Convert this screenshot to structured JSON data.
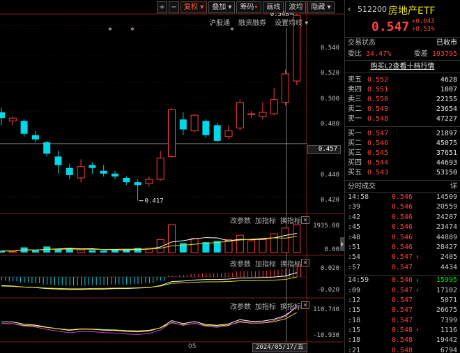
{
  "toolbar": {
    "plus": "+",
    "minus": "−",
    "fq": "复权",
    "overlay": "叠加",
    "chips": "筹码",
    "draw": "画线",
    "kline": "波均",
    "hide": "隐藏",
    "menu_arrow": "▾"
  },
  "sub_links": [
    "沪股通",
    "融资融券",
    "设置均线"
  ],
  "panel_tools": {
    "params": "改参数",
    "add": "加指标",
    "swap": "换指标"
  },
  "price_axis": [
    "0.540",
    "0.520",
    "0.500",
    "0.480",
    "0.460",
    "0.440",
    "0.420"
  ],
  "current_price_tag": "0.457",
  "high_label": "0.548",
  "low_label": "0.417",
  "volume_axis": [
    "1935.00",
    "0.00"
  ],
  "macd_axis": [
    "0.020",
    "-0.020"
  ],
  "ind3_axis": [
    "110.740",
    "-10.930"
  ],
  "x_tick": "05",
  "date_badge": "2024/05/17/五",
  "chart_data": {
    "type": "candlestick",
    "ylim": [
      0.41,
      0.55
    ],
    "candles": [
      {
        "o": 0.479,
        "h": 0.482,
        "l": 0.47,
        "c": 0.475
      },
      {
        "o": 0.473,
        "h": 0.476,
        "l": 0.47,
        "c": 0.475
      },
      {
        "o": 0.473,
        "h": 0.474,
        "l": 0.462,
        "c": 0.464
      },
      {
        "o": 0.463,
        "h": 0.466,
        "l": 0.458,
        "c": 0.46
      },
      {
        "o": 0.458,
        "h": 0.459,
        "l": 0.448,
        "c": 0.45
      },
      {
        "o": 0.448,
        "h": 0.452,
        "l": 0.436,
        "c": 0.442
      },
      {
        "o": 0.44,
        "h": 0.443,
        "l": 0.432,
        "c": 0.435
      },
      {
        "o": 0.433,
        "h": 0.446,
        "l": 0.43,
        "c": 0.441
      },
      {
        "o": 0.442,
        "h": 0.444,
        "l": 0.436,
        "c": 0.44
      },
      {
        "o": 0.438,
        "h": 0.442,
        "l": 0.434,
        "c": 0.436
      },
      {
        "o": 0.436,
        "h": 0.438,
        "l": 0.432,
        "c": 0.434
      },
      {
        "o": 0.433,
        "h": 0.434,
        "l": 0.428,
        "c": 0.43
      },
      {
        "o": 0.43,
        "h": 0.432,
        "l": 0.417,
        "c": 0.428
      },
      {
        "o": 0.429,
        "h": 0.434,
        "l": 0.427,
        "c": 0.432
      },
      {
        "o": 0.432,
        "h": 0.452,
        "l": 0.431,
        "c": 0.447
      },
      {
        "o": 0.448,
        "h": 0.482,
        "l": 0.447,
        "c": 0.481
      },
      {
        "o": 0.474,
        "h": 0.479,
        "l": 0.463,
        "c": 0.467
      },
      {
        "o": 0.466,
        "h": 0.478,
        "l": 0.465,
        "c": 0.477
      },
      {
        "o": 0.473,
        "h": 0.474,
        "l": 0.461,
        "c": 0.463
      },
      {
        "o": 0.47,
        "h": 0.472,
        "l": 0.458,
        "c": 0.459
      },
      {
        "o": 0.462,
        "h": 0.47,
        "l": 0.46,
        "c": 0.466
      },
      {
        "o": 0.468,
        "h": 0.488,
        "l": 0.466,
        "c": 0.486
      },
      {
        "o": 0.478,
        "h": 0.48,
        "l": 0.475,
        "c": 0.478
      },
      {
        "o": 0.476,
        "h": 0.486,
        "l": 0.474,
        "c": 0.479
      },
      {
        "o": 0.478,
        "h": 0.496,
        "l": 0.477,
        "c": 0.488
      },
      {
        "o": 0.486,
        "h": 0.509,
        "l": 0.484,
        "c": 0.506
      },
      {
        "o": 0.501,
        "h": 0.548,
        "l": 0.498,
        "c": 0.547
      }
    ],
    "volume": [
      120,
      80,
      360,
      150,
      420,
      260,
      300,
      180,
      160,
      140,
      200,
      210,
      320,
      300,
      900,
      1935,
      650,
      980,
      720,
      800,
      900,
      1200,
      820,
      900,
      1300,
      1700,
      1935
    ],
    "macd": [
      -0.006,
      -0.007,
      -0.009,
      -0.01,
      -0.012,
      -0.013,
      -0.014,
      -0.014,
      -0.013,
      -0.013,
      -0.012,
      -0.012,
      -0.011,
      -0.01,
      -0.006,
      0.002,
      0.003,
      0.005,
      0.006,
      0.006,
      0.007,
      0.009,
      0.009,
      0.01,
      0.011,
      0.013,
      0.02
    ]
  },
  "quote": {
    "code": "512200",
    "name": "房地产ETF",
    "price": "0.547",
    "change": "+0.043",
    "change_pct": "+8.53%",
    "status_label": "交易状态",
    "status_value": "已收市",
    "weibi_label": "委比",
    "weibi_value": "34.47%",
    "weicha_label": "委差",
    "weicha_value": "103795",
    "l2_link": "购买L2查看十档行情"
  },
  "asks": [
    {
      "label": "卖五",
      "price": "0.552",
      "vol": "4628"
    },
    {
      "label": "卖四",
      "price": "0.551",
      "vol": "1007"
    },
    {
      "label": "卖三",
      "price": "0.550",
      "vol": "22155"
    },
    {
      "label": "卖二",
      "price": "0.549",
      "vol": "23654"
    },
    {
      "label": "卖一",
      "price": "0.548",
      "vol": "47227"
    }
  ],
  "bids": [
    {
      "label": "买一",
      "price": "0.547",
      "vol": "21897"
    },
    {
      "label": "买二",
      "price": "0.546",
      "vol": "45075"
    },
    {
      "label": "买三",
      "price": "0.545",
      "vol": "37651"
    },
    {
      "label": "买四",
      "price": "0.544",
      "vol": "44693"
    },
    {
      "label": "买五",
      "price": "0.543",
      "vol": "53150"
    }
  ],
  "trades_header": {
    "title": "分时成交",
    "detail": "详"
  },
  "trades_a": [
    {
      "t": "14:58",
      "p": "0.546",
      "dir": "",
      "v": "14509"
    },
    {
      "t": ":39",
      "p": "0.546",
      "dir": "",
      "v": "20559"
    },
    {
      "t": ":42",
      "p": "0.546",
      "dir": "",
      "v": "24207"
    },
    {
      "t": ":45",
      "p": "0.546",
      "dir": "",
      "v": "23474"
    },
    {
      "t": ":48",
      "p": "0.546",
      "dir": "",
      "v": "44889"
    },
    {
      "t": ":51",
      "p": "0.546",
      "dir": "",
      "v": "28427"
    },
    {
      "t": ":54",
      "p": "0.547",
      "dir": "↑",
      "v": "2405"
    },
    {
      "t": ":57",
      "p": "0.547",
      "dir": "",
      "v": "4434"
    }
  ],
  "trades_b": [
    {
      "t": "14:59",
      "p": "0.546",
      "dir": "↓",
      "v": "15995"
    },
    {
      "t": ":09",
      "p": "0.547",
      "dir": "↑",
      "v": "17102"
    },
    {
      "t": ":12",
      "p": "0.547",
      "dir": "",
      "v": "5071"
    },
    {
      "t": ":15",
      "p": "0.547",
      "dir": "",
      "v": "26675"
    },
    {
      "t": ":18",
      "p": "0.547",
      "dir": "",
      "v": "7399"
    },
    {
      "t": ":15",
      "p": "0.548",
      "dir": "↑",
      "v": "1116"
    },
    {
      "t": ":18",
      "p": "0.548",
      "dir": "",
      "v": "19442"
    },
    {
      "t": ":21",
      "p": "0.548",
      "dir": "",
      "v": "6794"
    }
  ]
}
